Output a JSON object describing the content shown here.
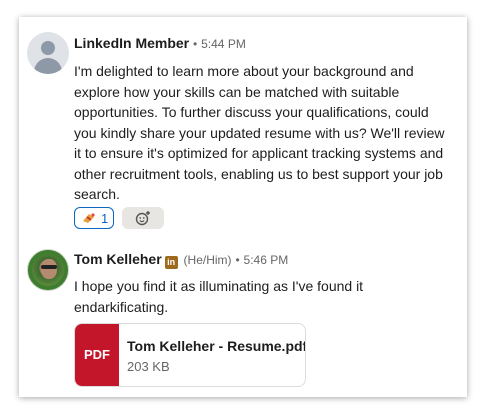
{
  "messages": [
    {
      "sender": "LinkedIn Member",
      "separator": "•",
      "time": "5:44 PM",
      "text": "I'm delighted to learn more about your background and explore how your skills can be matched with suitable opportunities. To further discuss your qualifications, could you kindly share your updated resume with us? We'll review it to ensure it's optimized for applicant tracking systems and other recruitment tools, enabling us to best support your job search.",
      "reaction": {
        "emoji": "bandage-emoji",
        "count": "1"
      },
      "add_reaction_icon": "add-reaction-icon"
    },
    {
      "sender": "Tom Kelleher",
      "badge": "in",
      "pronouns": "(He/Him)",
      "separator": "•",
      "time": "5:46 PM",
      "text": "I hope you find it as illuminating as I've found it endarkificating.",
      "attachment": {
        "type_label": "PDF",
        "file_name": "Tom Kelleher - Resume.pdf",
        "file_size": "203 KB"
      }
    }
  ],
  "colors": {
    "pdf_red": "#c4162a",
    "reaction_blue": "#0a66c2",
    "linkedin_badge": "#9e6a1d"
  }
}
